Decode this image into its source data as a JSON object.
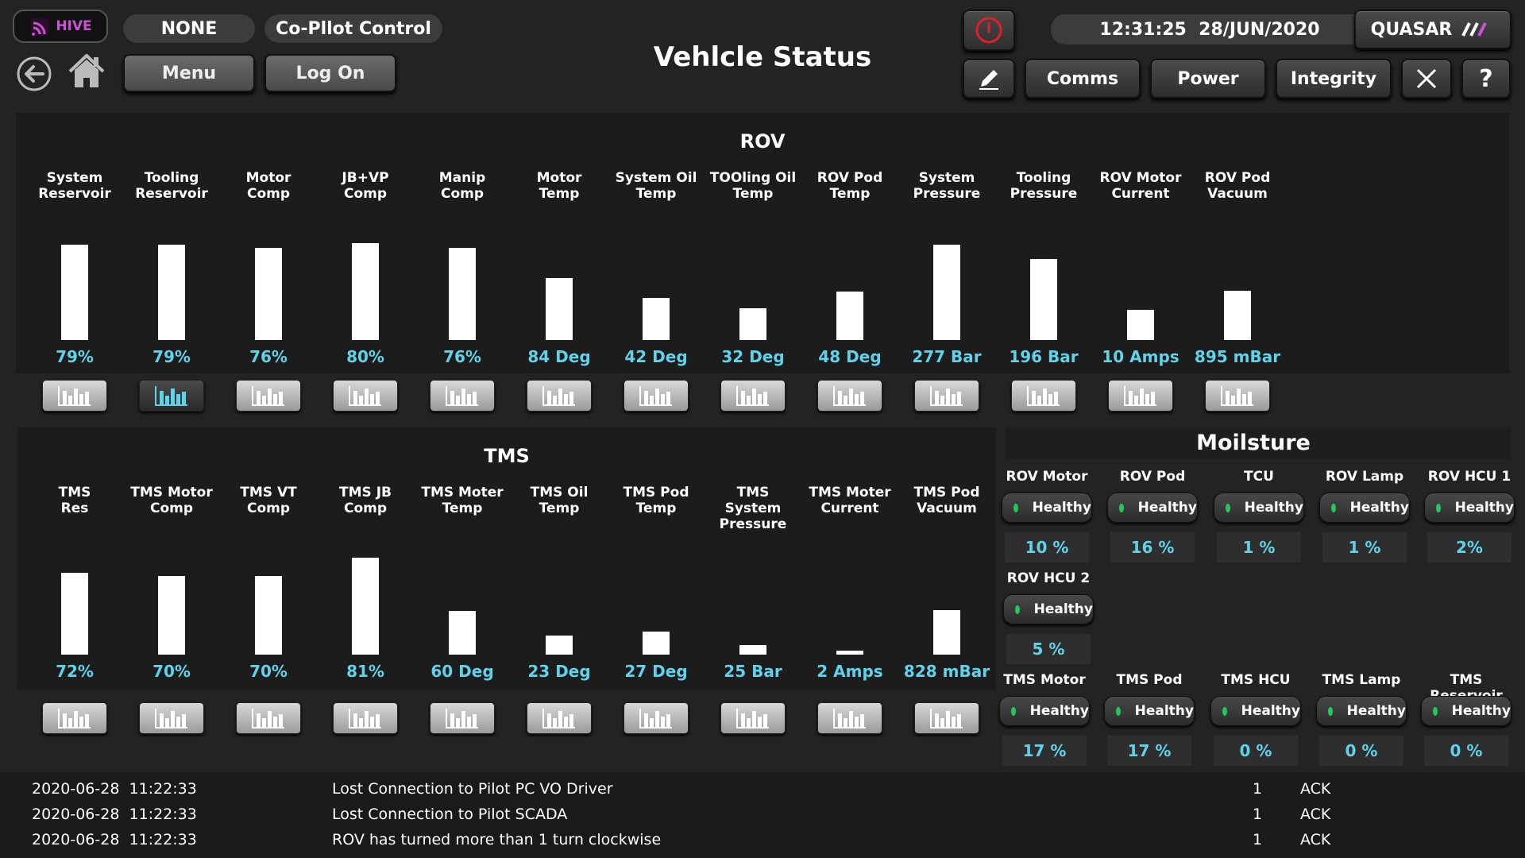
{
  "header": {
    "logo_text": "HIVE",
    "mode_pill": "NONE",
    "copilot_pill": "Co-Pllot Control",
    "menu_label": "Menu",
    "logon_label": "Log On",
    "title": "Vehlcle Status",
    "datetime": "12:31:25  28/JUN/2020",
    "brand_label": "QUASAR",
    "comms_label": "Comms",
    "power_label": "Power",
    "integrity_label": "Integrity",
    "help_label": "?"
  },
  "rov": {
    "title": "ROV",
    "bars": [
      {
        "label": "System\nReservoir",
        "fill": 0.79,
        "value": "79%"
      },
      {
        "label": "Tooling\nReservoir",
        "fill": 0.79,
        "value": "79%"
      },
      {
        "label": "Motor\nComp",
        "fill": 0.76,
        "value": "76%"
      },
      {
        "label": "JB+VP\nComp",
        "fill": 0.8,
        "value": "80%"
      },
      {
        "label": "Manip\nComp",
        "fill": 0.76,
        "value": "76%"
      },
      {
        "label": "Motor\nTemp",
        "fill": 0.51,
        "value": "84 Deg"
      },
      {
        "label": "System Oil\nTemp",
        "fill": 0.35,
        "value": "42 Deg"
      },
      {
        "label": "TOOling Oil\nTemp",
        "fill": 0.26,
        "value": "32 Deg"
      },
      {
        "label": "ROV Pod\nTemp",
        "fill": 0.4,
        "value": "48 Deg"
      },
      {
        "label": "System\nPressure",
        "fill": 0.79,
        "value": "277 Bar"
      },
      {
        "label": "Tooling\nPressure",
        "fill": 0.67,
        "value": "196 Bar"
      },
      {
        "label": "ROV Motor\nCurrent",
        "fill": 0.25,
        "value": "10 Amps"
      },
      {
        "label": "ROV Pod\nVacuum",
        "fill": 0.41,
        "value": "895 mBar"
      }
    ],
    "active_chart_index": 1
  },
  "tms": {
    "title": "TMS",
    "bars": [
      {
        "label": "TMS\nRes",
        "fill": 0.68,
        "value": "72%"
      },
      {
        "label": "TMS Motor\nComp",
        "fill": 0.65,
        "value": "70%"
      },
      {
        "label": "TMS VT\nComp",
        "fill": 0.65,
        "value": "70%"
      },
      {
        "label": "TMS JB\nComp",
        "fill": 0.8,
        "value": "81%"
      },
      {
        "label": "TMS Moter\nTemp",
        "fill": 0.36,
        "value": "60 Deg"
      },
      {
        "label": "TMS Oil\nTemp",
        "fill": 0.16,
        "value": "23 Deg"
      },
      {
        "label": "TMS Pod\nTemp",
        "fill": 0.19,
        "value": "27 Deg"
      },
      {
        "label": "TMS System\nPressure",
        "fill": 0.08,
        "value": "25 Bar"
      },
      {
        "label": "TMS Moter\nCurrent",
        "fill": 0.03,
        "value": "2 Amps"
      },
      {
        "label": "TMS Pod\nVacuum",
        "fill": 0.37,
        "value": "828 mBar"
      }
    ]
  },
  "moisture": {
    "title": "Moilsture",
    "rows": [
      [
        {
          "label": "ROV Motor",
          "status": "Healthy",
          "pct": "10 %"
        },
        {
          "label": "ROV Pod",
          "status": "Healthy",
          "pct": "16 %"
        },
        {
          "label": "TCU",
          "status": "Healthy",
          "pct": "1 %"
        },
        {
          "label": "ROV Lamp",
          "status": "Healthy",
          "pct": "1 %"
        },
        {
          "label": "ROV HCU 1",
          "status": "Healthy",
          "pct": "2%"
        }
      ],
      [
        {
          "label": "ROV HCU 2",
          "status": "Healthy",
          "pct": "5 %"
        }
      ],
      [
        {
          "label": "TMS Motor",
          "status": "Healthy",
          "pct": "17 %"
        },
        {
          "label": "TMS Pod",
          "status": "Healthy",
          "pct": "17 %"
        },
        {
          "label": "TMS HCU",
          "status": "Healthy",
          "pct": "0 %"
        },
        {
          "label": "TMS Lamp",
          "status": "Healthy",
          "pct": "0 %"
        },
        {
          "label": "TMS Reservoir",
          "status": "Healthy",
          "pct": "0 %"
        }
      ]
    ]
  },
  "alarms": [
    {
      "time": "2020-06-28  11:22:33",
      "message": "Lost Connection to Pilot PC VO Driver",
      "count": "1",
      "status": "ACK"
    },
    {
      "time": "2020-06-28  11:22:33",
      "message": "Lost Connection to Pilot SCADA",
      "count": "1",
      "status": "ACK"
    },
    {
      "time": "2020-06-28  11:22:33",
      "message": "ROV has turned more than 1 turn clockwise",
      "count": "1",
      "status": "ACK"
    }
  ],
  "colors": {
    "accent_value": "#5ed3ea",
    "healthy": "#22c55e",
    "power_red": "#e11d2a",
    "logo_magenta": "#d04fd8"
  },
  "icons": [
    "back-arrow-icon",
    "home-icon",
    "power-icon",
    "pencil-icon",
    "close-icon",
    "bar-chart-icon",
    "wifi-icon"
  ]
}
